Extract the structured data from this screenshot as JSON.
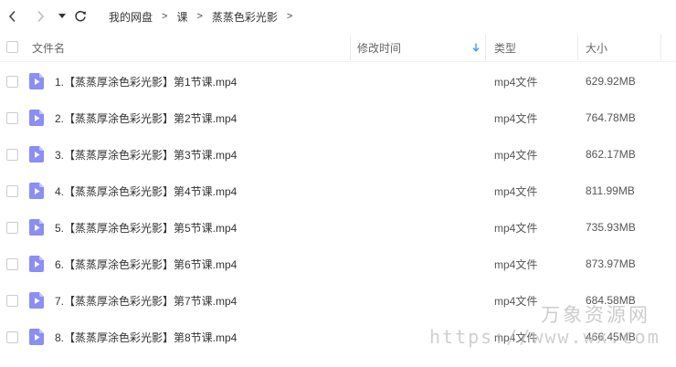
{
  "breadcrumb": {
    "items": [
      "我的网盘",
      "课",
      "蒸蒸色彩光影"
    ],
    "separator": ">"
  },
  "icons": {
    "back": "chevron-left-icon",
    "forward": "chevron-right-icon",
    "history": "caret-down-icon",
    "refresh": "refresh-icon",
    "sort": "arrow-down-icon",
    "file": "video-file-icon"
  },
  "colors": {
    "accent": "#3b9ff3",
    "file_icon": "#8b8ef2",
    "file_icon_fold": "#c3c5fa"
  },
  "columns": {
    "name": "文件名",
    "modified": "修改时间",
    "type": "类型",
    "size": "大小"
  },
  "files": [
    {
      "name": "1.【蒸蒸厚涂色彩光影】第1节课.mp4",
      "modified": "",
      "type": "mp4文件",
      "size": "629.92MB"
    },
    {
      "name": "2.【蒸蒸厚涂色彩光影】第2节课.mp4",
      "modified": "",
      "type": "mp4文件",
      "size": "764.78MB"
    },
    {
      "name": "3.【蒸蒸厚涂色彩光影】第3节课.mp4",
      "modified": "",
      "type": "mp4文件",
      "size": "862.17MB"
    },
    {
      "name": "4.【蒸蒸厚涂色彩光影】第4节课.mp4",
      "modified": "",
      "type": "mp4文件",
      "size": "811.99MB"
    },
    {
      "name": "5.【蒸蒸厚涂色彩光影】第5节课.mp4",
      "modified": "",
      "type": "mp4文件",
      "size": "735.93MB"
    },
    {
      "name": "6.【蒸蒸厚涂色彩光影】第6节课.mp4",
      "modified": "",
      "type": "mp4文件",
      "size": "873.97MB"
    },
    {
      "name": "7.【蒸蒸厚涂色彩光影】第7节课.mp4",
      "modified": "",
      "type": "mp4文件",
      "size": "684.58MB"
    },
    {
      "name": "8.【蒸蒸厚涂色彩光影】第8节课.mp4",
      "modified": "",
      "type": "mp4文件",
      "size": "466.45MB"
    }
  ],
  "watermark": {
    "text_cn": "万象资源网",
    "text_url": "https://www.wx.com"
  }
}
